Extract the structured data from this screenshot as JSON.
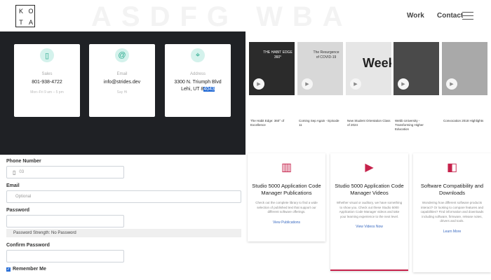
{
  "header": {
    "logo_letters": [
      "K",
      "O",
      "T",
      "A"
    ],
    "bg_letters": "ASDFG WBA",
    "nav": {
      "work": "Work",
      "contact": "Contact"
    }
  },
  "contact_cards": [
    {
      "icon": "phone-icon",
      "glyph": "▯",
      "label": "Sales",
      "value": "801-938-4722",
      "sub": "Mon–Fri 9 am – 5 pm"
    },
    {
      "icon": "at-icon",
      "glyph": "@",
      "label": "Email",
      "value": "info@strides.dev",
      "sub": "Say Hi"
    },
    {
      "icon": "map-pin-icon",
      "glyph": "⌖",
      "label": "Address",
      "value_line1": "3300 N. Triumph Blvd",
      "value_line2a": "Lehi, UT 8",
      "value_line2b": "4043"
    }
  ],
  "form": {
    "phone_label": "Phone Number",
    "phone_value": "03",
    "email_label": "Email",
    "email_placeholder": "Optional",
    "password_label": "Password",
    "strength_text": "Password Strength: No Password",
    "confirm_label": "Confirm Password",
    "remember_label": "Remember Me"
  },
  "videos": [
    {
      "title": "The Habit Edge: 360° of Excellence",
      "overlay": "THE HABIT EDGE 360°"
    },
    {
      "title": "Coming Sep Again - Episode 11",
      "overlay": "The Resurgence of COVID-19"
    },
    {
      "title": "New Student Orientation Class of 2024",
      "overlay": "Week"
    },
    {
      "title": "Webb University - Transforming Higher Education",
      "overlay": ""
    },
    {
      "title": "Convocation 2018 Highlights",
      "overlay": ""
    }
  ],
  "resources": [
    {
      "icon": "books-icon",
      "glyph": "▥",
      "title": "Studio 5000 Application Code Manager Publications",
      "desc": "Check out the complete library to find a wide selection of published text that support our different software offerings.",
      "link": "View Publications"
    },
    {
      "icon": "play-icon",
      "glyph": "▶",
      "title": "Studio 5000 Application Code Manager Videos",
      "desc": "Whether visual or auditory, we have something to show you. Check out these Studio 5000 Application Code Manager videos and take your learning experience to the next level.",
      "link": "View Videos Now"
    },
    {
      "icon": "compat-icon",
      "glyph": "◧",
      "title": "Software Compatibility and Downloads",
      "desc": "Wondering how different software products interact? Or looking to compare features and capabilities? Find information and downloads including software, firmware, release notes, drivers and tools.",
      "link": "Learn More"
    }
  ]
}
